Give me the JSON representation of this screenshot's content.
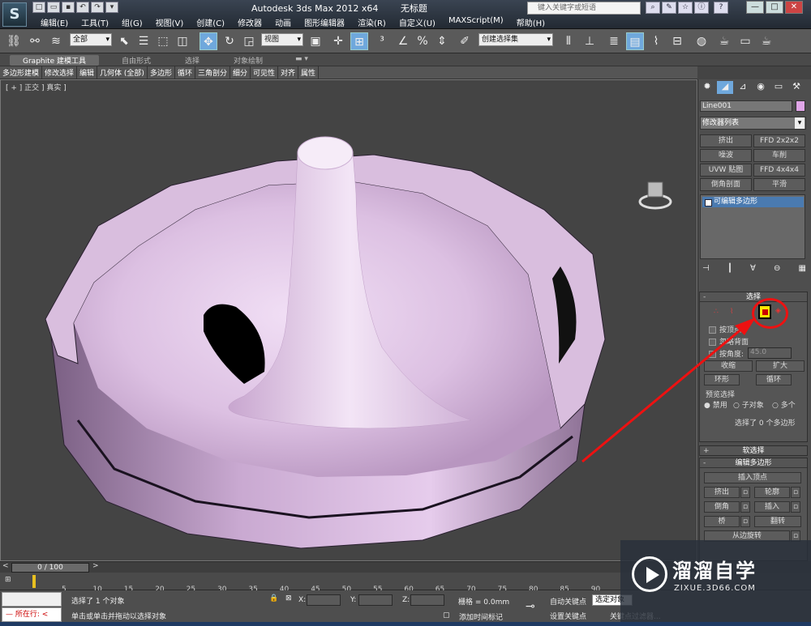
{
  "titlebar": {
    "logo": "S",
    "title": "Autodesk 3ds Max  2012 x64",
    "doc": "无标题",
    "search_placeholder": "键入关键字或短语",
    "menu": [
      "编辑(E)",
      "工具(T)",
      "组(G)",
      "视图(V)",
      "创建(C)",
      "修改器",
      "动画",
      "图形编辑器",
      "渲染(R)",
      "自定义(U)",
      "MAXScript(M)",
      "帮助(H)"
    ],
    "min": "—",
    "max": "□",
    "close": "✕",
    "help": "?"
  },
  "toolbar": {
    "filter": "全部",
    "refcoord": "视图",
    "selset": "创建选择集"
  },
  "ribbon": {
    "tabs": [
      "Graphite 建模工具",
      "自由形式",
      "选择",
      "对象绘制"
    ],
    "subtabs": [
      "多边形建模",
      "修改选择",
      "编辑",
      "几何体 (全部)",
      "多边形",
      "循环",
      "三角剖分",
      "细分",
      "可见性",
      "对齐",
      "属性"
    ]
  },
  "viewport": {
    "label": "[ + ] 正交 ] 真实 ]"
  },
  "command_panel": {
    "object_name": "Line001",
    "modifier_list": "修改器列表",
    "mod_buttons": [
      "挤出",
      "FFD 2x2x2",
      "噪波",
      "车削",
      "UVW 贴图",
      "FFD 4x4x4",
      "倒角剖面",
      "平滑"
    ],
    "stack_item": "可编辑多边形",
    "selection": {
      "title": "选择",
      "by_vertex": "按顶点",
      "ignore_back": "忽略背面",
      "by_angle": "按角度:",
      "angle": "45.0",
      "shrink": "收缩",
      "grow": "扩大",
      "ring": "环形",
      "loop": "循环",
      "preview": "预览选择",
      "disable": "禁用",
      "sub_object": "子对象",
      "multi": "多个",
      "status": "选择了 0 个多边形"
    },
    "soft_select": "软选择",
    "edit_poly": {
      "title": "编辑多边形",
      "insert_vertex": "插入顶点",
      "extrude": "挤出",
      "outline": "轮廓",
      "bevel": "倒角",
      "inset": "插入",
      "bridge": "桥",
      "flip": "翻转",
      "hinge": "从边旋转",
      "rotate": "旋转"
    }
  },
  "timeline": {
    "slider": "0 / 100",
    "ticks": [
      "5",
      "10",
      "15",
      "20",
      "25",
      "30",
      "35",
      "40",
      "45",
      "50",
      "55",
      "60",
      "65",
      "70",
      "75",
      "80",
      "85",
      "90"
    ]
  },
  "status": {
    "running": "所在行:",
    "selected": "选择了 1 个对象",
    "prompt": "单击或单击并拖动以选择对象",
    "x_label": "X:",
    "y_label": "Y:",
    "z_label": "Z:",
    "grid": "栅格 = 0.0mm",
    "auto_key": "自动关键点",
    "selected_obj": "选定对象",
    "set_key": "设置关键点",
    "key_filter": "关键点过滤器...",
    "add_marker": "添加时间标记"
  },
  "watermark": {
    "title": "溜溜自学",
    "sub": "ZIXUE.3D66.COM"
  }
}
